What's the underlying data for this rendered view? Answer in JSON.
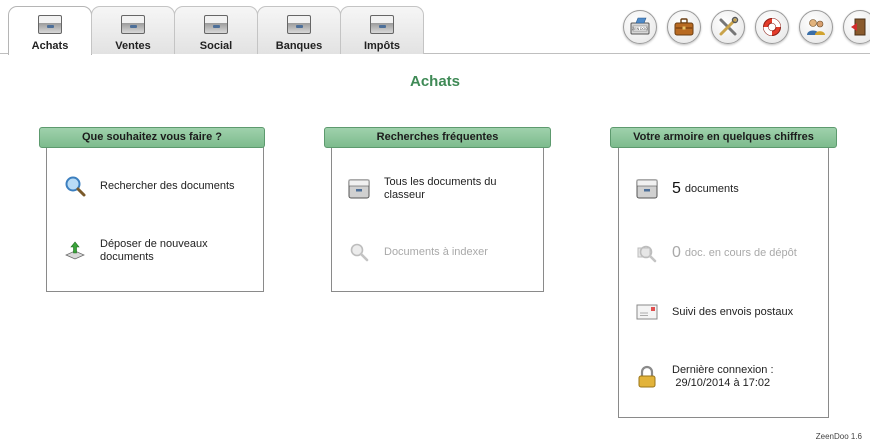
{
  "tabs": [
    {
      "label": "Achats",
      "active": true
    },
    {
      "label": "Ventes",
      "active": false
    },
    {
      "label": "Social",
      "active": false
    },
    {
      "label": "Banques",
      "active": false
    },
    {
      "label": "Impôts",
      "active": false
    }
  ],
  "toolbar": {
    "icons": [
      "scanner-icon",
      "briefcase-icon",
      "tools-icon",
      "lifebuoy-icon",
      "users-icon",
      "logout-icon"
    ],
    "scanner_badge": "ZEN DOO"
  },
  "page": {
    "title": "Achats"
  },
  "panels": {
    "actions": {
      "header": "Que souhaitez vous faire ?",
      "items": [
        {
          "label": "Rechercher des documents",
          "icon": "magnifier-icon"
        },
        {
          "label": "Déposer de nouveaux documents",
          "icon": "upload-icon"
        }
      ]
    },
    "recherches": {
      "header": "Recherches fréquentes",
      "items": [
        {
          "label": "Tous les documents du classeur",
          "icon": "cabinet-icon"
        },
        {
          "label": "Documents à indexer",
          "icon": "index-search-icon",
          "disabled": true
        }
      ]
    },
    "stats": {
      "header": "Votre armoire en quelques chiffres",
      "documents_count": "5",
      "documents_label": "documents",
      "pending_count": "0",
      "pending_label": "doc. en cours de dépôt",
      "postal_label": "Suivi des envois postaux",
      "last_login_label": "Dernière connexion :",
      "last_login_value": "29/10/2014 à 17:02"
    }
  },
  "footer": {
    "version": "ZeenDoo 1.6"
  },
  "colors": {
    "accent_green": "#3f8a56",
    "header_green": "#8cc79b"
  }
}
